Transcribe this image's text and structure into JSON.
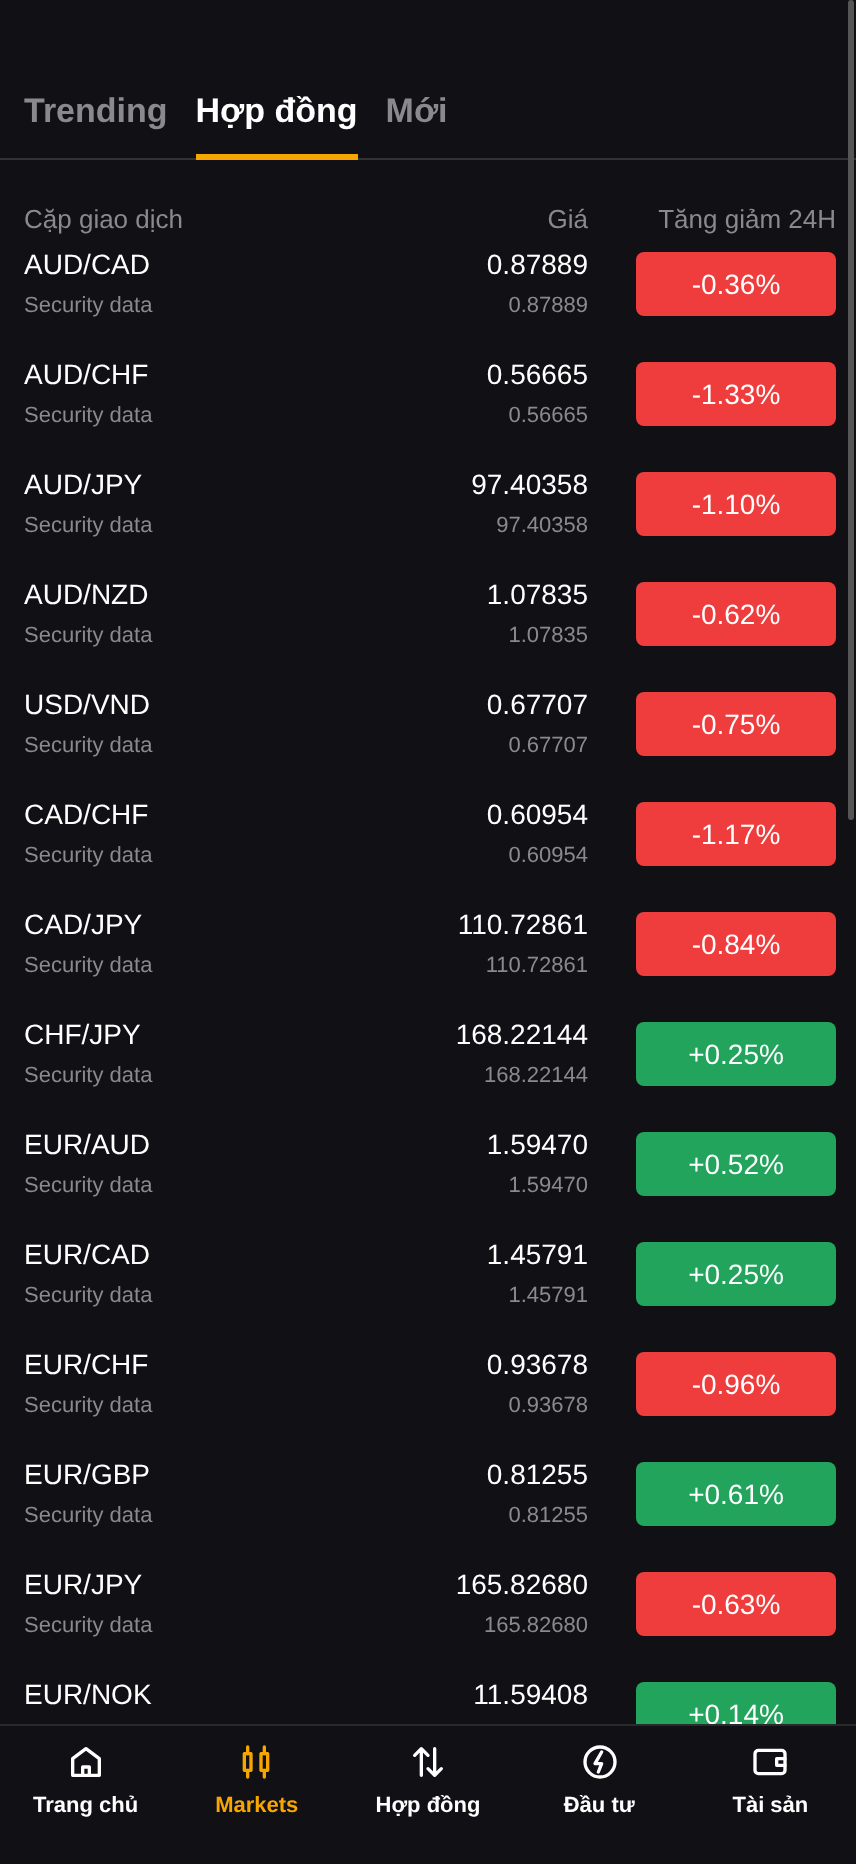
{
  "tabs": [
    {
      "label": "Trending",
      "selected": false
    },
    {
      "label": "Hợp đồng",
      "selected": true
    },
    {
      "label": "Mới",
      "selected": false
    }
  ],
  "columns": {
    "pair": "Cặp giao dịch",
    "price": "Giá",
    "change": "Tăng giảm 24H"
  },
  "rows": [
    {
      "pair": "AUD/CAD",
      "sub": "Security data",
      "price": "0.87889",
      "sub_price": "0.87889",
      "change": "-0.36%",
      "color": "#ef3c3c"
    },
    {
      "pair": "AUD/CHF",
      "sub": "Security data",
      "price": "0.56665",
      "sub_price": "0.56665",
      "change": "-1.33%",
      "color": "#ef3c3c"
    },
    {
      "pair": "AUD/JPY",
      "sub": "Security data",
      "price": "97.40358",
      "sub_price": "97.40358",
      "change": "-1.10%",
      "color": "#ef3c3c"
    },
    {
      "pair": "AUD/NZD",
      "sub": "Security data",
      "price": "1.07835",
      "sub_price": "1.07835",
      "change": "-0.62%",
      "color": "#ef3c3c"
    },
    {
      "pair": "USD/VND",
      "sub": "Security data",
      "price": "0.67707",
      "sub_price": "0.67707",
      "change": "-0.75%",
      "color": "#ef3c3c"
    },
    {
      "pair": "CAD/CHF",
      "sub": "Security data",
      "price": "0.60954",
      "sub_price": "0.60954",
      "change": "-1.17%",
      "color": "#ef3c3c"
    },
    {
      "pair": "CAD/JPY",
      "sub": "Security data",
      "price": "110.72861",
      "sub_price": "110.72861",
      "change": "-0.84%",
      "color": "#ef3c3c"
    },
    {
      "pair": "CHF/JPY",
      "sub": "Security data",
      "price": "168.22144",
      "sub_price": "168.22144",
      "change": "+0.25%",
      "color": "#22a45d"
    },
    {
      "pair": "EUR/AUD",
      "sub": "Security data",
      "price": "1.59470",
      "sub_price": "1.59470",
      "change": "+0.52%",
      "color": "#22a45d"
    },
    {
      "pair": "EUR/CAD",
      "sub": "Security data",
      "price": "1.45791",
      "sub_price": "1.45791",
      "change": "+0.25%",
      "color": "#22a45d"
    },
    {
      "pair": "EUR/CHF",
      "sub": "Security data",
      "price": "0.93678",
      "sub_price": "0.93678",
      "change": "-0.96%",
      "color": "#ef3c3c"
    },
    {
      "pair": "EUR/GBP",
      "sub": "Security data",
      "price": "0.81255",
      "sub_price": "0.81255",
      "change": "+0.61%",
      "color": "#22a45d"
    },
    {
      "pair": "EUR/JPY",
      "sub": "Security data",
      "price": "165.82680",
      "sub_price": "165.82680",
      "change": "-0.63%",
      "color": "#ef3c3c"
    },
    {
      "pair": "EUR/NOK",
      "price": "11.59408",
      "change": "+0.14%",
      "color": "#22a45d"
    }
  ],
  "nav": [
    {
      "label": "Trang chủ",
      "kind": "home",
      "selected": false
    },
    {
      "label": "Markets",
      "kind": "candles",
      "selected": true
    },
    {
      "label": "Hợp đồng",
      "kind": "arrows",
      "selected": false
    },
    {
      "label": "Đầu tư",
      "kind": "bolt",
      "selected": false
    },
    {
      "label": "Tài sản",
      "kind": "wallet",
      "selected": false
    }
  ]
}
